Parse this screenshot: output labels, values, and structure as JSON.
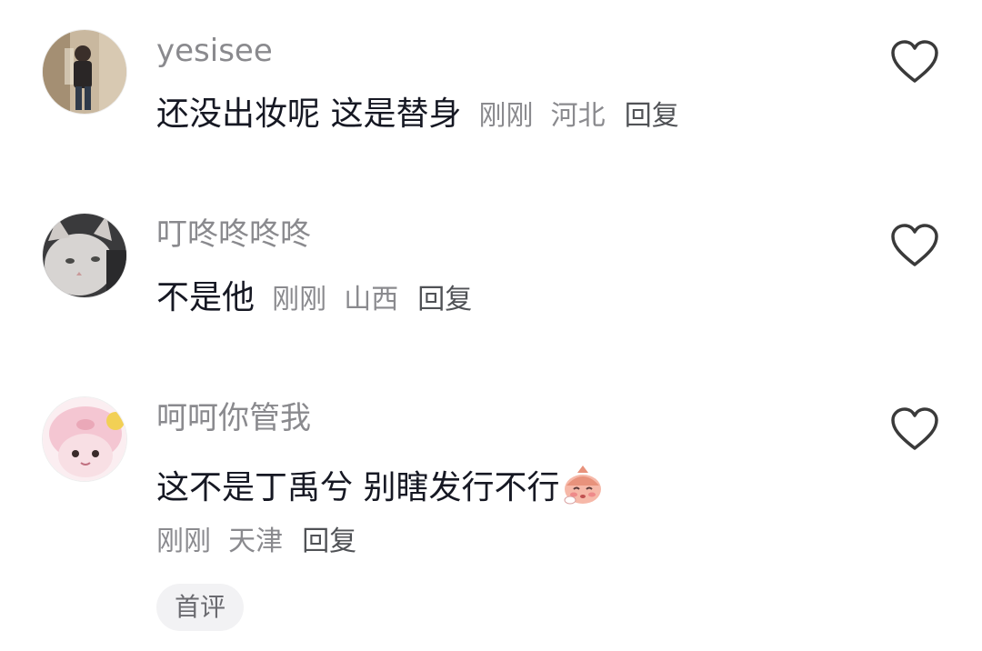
{
  "comments": [
    {
      "username": "yesisee",
      "text": "还没出妆呢 这是替身",
      "time": "刚刚",
      "location": "河北",
      "reply_label": "回复"
    },
    {
      "username": "叮咚咚咚咚",
      "text": "不是他",
      "time": "刚刚",
      "location": "山西",
      "reply_label": "回复"
    },
    {
      "username": "呵呵你管我",
      "text": "这不是丁禹兮 别瞎发行不行",
      "time": "刚刚",
      "location": "天津",
      "reply_label": "回复",
      "emoji": "blushing-face-emoji",
      "badge": "首评"
    }
  ],
  "icons": {
    "like": "heart-outline-icon"
  },
  "colors": {
    "username": "#8a8a8e",
    "body": "#161823",
    "meta": "#8a8a8e",
    "reply": "#505256",
    "badge_bg": "#f2f2f4"
  }
}
